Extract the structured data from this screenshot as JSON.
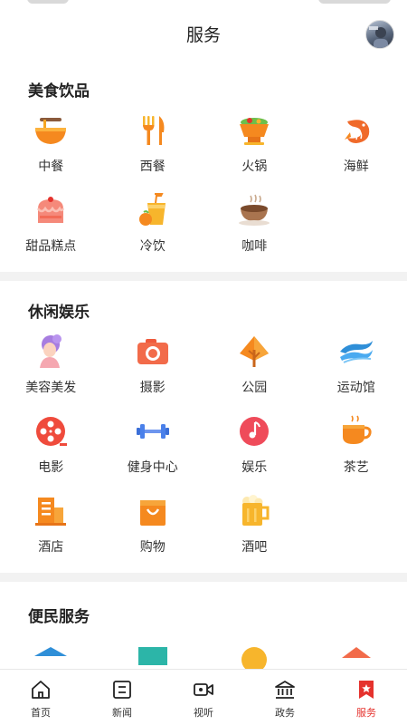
{
  "header": {
    "title": "服务"
  },
  "colors": {
    "accent": "#e5322d",
    "icon_orange": "#f5891f",
    "icon_yellow": "#f7b52c"
  },
  "sections": [
    {
      "title": "美食饮品",
      "items": [
        {
          "label": "中餐",
          "icon": "noodle-bowl-icon"
        },
        {
          "label": "西餐",
          "icon": "fork-knife-icon"
        },
        {
          "label": "火锅",
          "icon": "hotpot-icon"
        },
        {
          "label": "海鲜",
          "icon": "shrimp-icon"
        },
        {
          "label": "甜品糕点",
          "icon": "cake-icon"
        },
        {
          "label": "冷饮",
          "icon": "cold-drink-icon"
        },
        {
          "label": "咖啡",
          "icon": "coffee-icon"
        }
      ]
    },
    {
      "title": "休闲娱乐",
      "items": [
        {
          "label": "美容美发",
          "icon": "beauty-salon-icon"
        },
        {
          "label": "摄影",
          "icon": "camera-icon"
        },
        {
          "label": "公园",
          "icon": "tree-icon"
        },
        {
          "label": "运动馆",
          "icon": "swimming-wave-icon"
        },
        {
          "label": "电影",
          "icon": "film-reel-icon"
        },
        {
          "label": "健身中心",
          "icon": "dumbbell-icon"
        },
        {
          "label": "娱乐",
          "icon": "music-note-icon"
        },
        {
          "label": "茶艺",
          "icon": "tea-cup-icon"
        },
        {
          "label": "酒店",
          "icon": "hotel-building-icon"
        },
        {
          "label": "购物",
          "icon": "shopping-bag-icon"
        },
        {
          "label": "酒吧",
          "icon": "beer-mug-icon"
        }
      ]
    },
    {
      "title": "便民服务",
      "items": []
    }
  ],
  "tabbar": [
    {
      "label": "首页",
      "icon": "home-icon",
      "active": false
    },
    {
      "label": "新闻",
      "icon": "news-icon",
      "active": false
    },
    {
      "label": "视听",
      "icon": "video-icon",
      "active": false
    },
    {
      "label": "政务",
      "icon": "government-building-icon",
      "active": false
    },
    {
      "label": "服务",
      "icon": "service-bookmark-icon",
      "active": true
    }
  ]
}
